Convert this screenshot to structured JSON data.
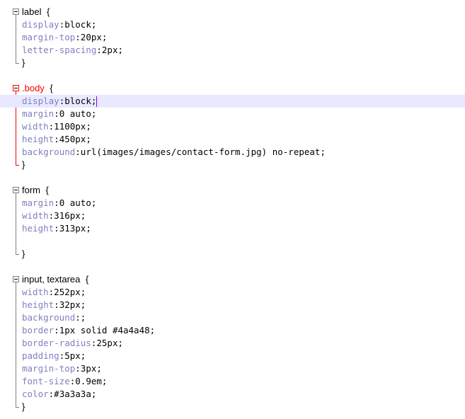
{
  "editor": {
    "blocks": [
      {
        "selector": "label",
        "selector_class": false,
        "active": false,
        "decls": [
          {
            "prop": "display",
            "val": "block;"
          },
          {
            "prop": "margin-top",
            "val": "20px;"
          },
          {
            "prop": "letter-spacing",
            "val": "2px;"
          }
        ],
        "extra_blank": false
      },
      {
        "selector": ".body",
        "selector_class": true,
        "active": true,
        "decls": [
          {
            "prop": "display",
            "val": "block;"
          },
          {
            "prop": "margin",
            "val": "0 auto;"
          },
          {
            "prop": "width",
            "val": "1100px;"
          },
          {
            "prop": "height",
            "val": "450px;"
          },
          {
            "prop": "background",
            "val": "url(images/images/contact-form.jpg) no-repeat;"
          }
        ],
        "extra_blank": false
      },
      {
        "selector": "form",
        "selector_class": false,
        "active": false,
        "decls": [
          {
            "prop": "margin",
            "val": "0 auto;"
          },
          {
            "prop": "width",
            "val": "316px;"
          },
          {
            "prop": "height",
            "val": "313px;"
          }
        ],
        "extra_blank": true
      },
      {
        "selector": "input, textarea",
        "selector_class": false,
        "active": false,
        "decls": [
          {
            "prop": "width",
            "val": "252px;"
          },
          {
            "prop": "height",
            "val": "32px;"
          },
          {
            "prop": "background",
            "val": ";"
          },
          {
            "prop": "border",
            "val": "1px solid #4a4a48;"
          },
          {
            "prop": "border-radius",
            "val": "25px;"
          },
          {
            "prop": "padding",
            "val": "5px;"
          },
          {
            "prop": "margin-top",
            "val": "3px;"
          },
          {
            "prop": "font-size",
            "val": "0.9em;"
          },
          {
            "prop": "color",
            "val": "#3a3a3a;"
          }
        ],
        "extra_blank": false
      }
    ],
    "open_brace": "{",
    "close_brace": "}",
    "colon": ":",
    "colors": {
      "property": "#8080c0",
      "class_selector": "#ff0000",
      "current_line": "#e8e8ff",
      "fold_active": "#ff0000",
      "fold_normal": "#808080",
      "caret": "#8000ff"
    }
  }
}
